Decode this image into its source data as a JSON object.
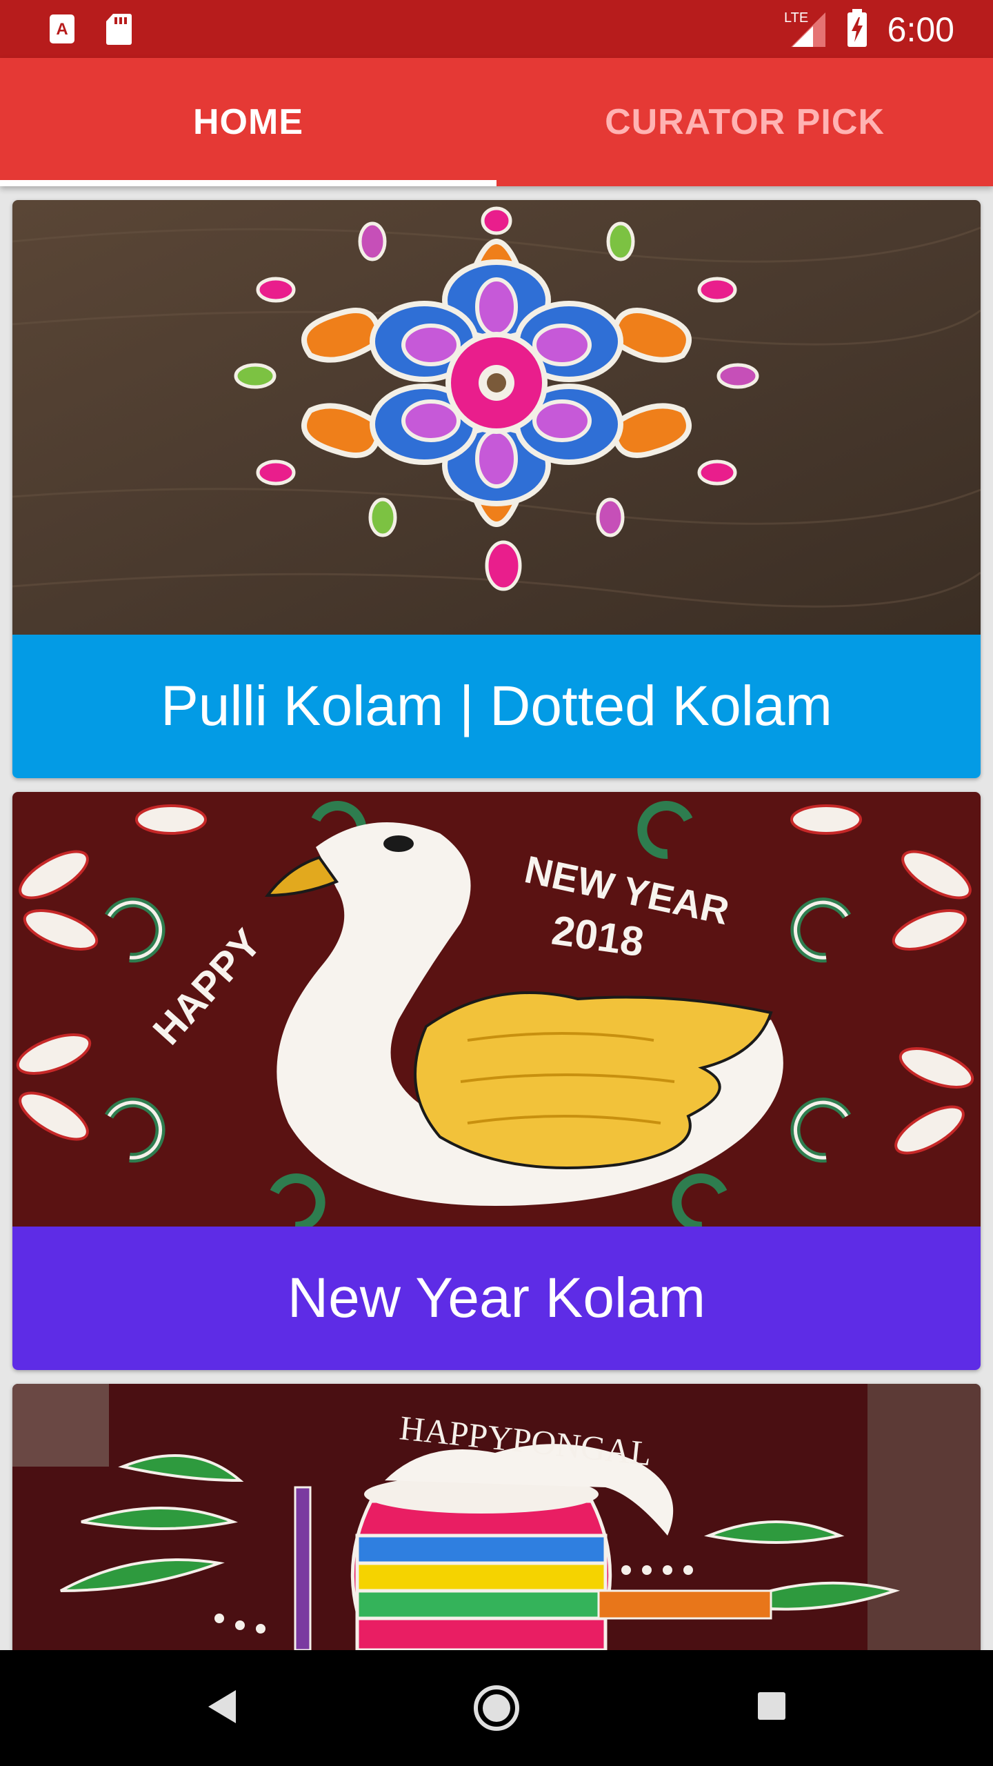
{
  "status_bar": {
    "time": "6:00",
    "network": "LTE",
    "icons": [
      "app-notification-icon",
      "sd-card-icon",
      "signal-icon",
      "battery-charging-icon"
    ]
  },
  "tabs": [
    {
      "label": "HOME",
      "selected": true
    },
    {
      "label": "CURATOR PICK",
      "selected": false
    }
  ],
  "cards": [
    {
      "title": "Pulli Kolam | Dotted Kolam",
      "color": "#039be5"
    },
    {
      "title": "New Year Kolam",
      "color": "#5e2ce6"
    },
    {
      "title": "",
      "color": "#3a0d0d"
    }
  ],
  "artwork": {
    "card2_text": [
      "HAPPY",
      "NEW YEAR",
      "2018"
    ],
    "card3_text": "HAPPYPONGAL"
  },
  "nav": [
    "back-icon",
    "home-icon",
    "recents-icon"
  ]
}
